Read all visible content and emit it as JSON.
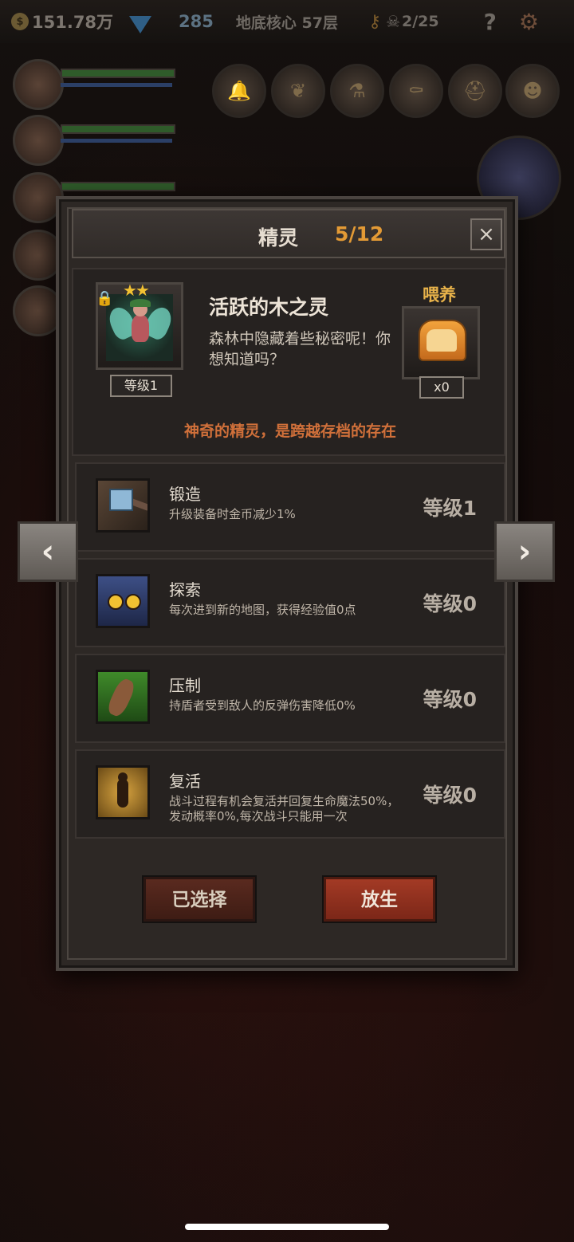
{
  "topbar": {
    "gold": "151.78万",
    "gems": "285",
    "floor": "地底核心 57层",
    "kills": "2/25",
    "icons": [
      "coin-icon",
      "gem-icon",
      "key-icon",
      "skull-icon",
      "help-icon",
      "gear-icon"
    ]
  },
  "dialog": {
    "title": "精灵",
    "count": "5/12",
    "close_label": "×",
    "spirit": {
      "name": "活跃的木之灵",
      "description": "森林中隐藏着些秘密呢！你想知道吗？",
      "stars": "★★",
      "level": "等级1",
      "feed_label": "喂养",
      "feed_count": "x0"
    },
    "motto": "神奇的精灵，是跨越存档的存在",
    "skills": [
      {
        "name": "锻造",
        "description": "升级装备时金币减少1%",
        "level": "等级1",
        "icon": "hammer-icon"
      },
      {
        "name": "探索",
        "description": "每次进到新的地图，获得经验值0点",
        "level": "等级0",
        "icon": "owl-icon"
      },
      {
        "name": "压制",
        "description": "持盾者受到敌人的反弹伤害降低0%",
        "level": "等级0",
        "icon": "claw-icon"
      },
      {
        "name": "复活",
        "description": "战斗过程有机会复活并回复生命魔法50%，发动概率0%,每次战斗只能用一次",
        "level": "等级0",
        "icon": "revive-icon"
      }
    ],
    "buttons": {
      "selected": "已选择",
      "release": "放生"
    }
  },
  "nav": {
    "prev": "‹",
    "next": "›"
  },
  "colors": {
    "accent_orange": "#e39a35",
    "motto_red": "#d0703a",
    "release_button": "#a33a25"
  }
}
